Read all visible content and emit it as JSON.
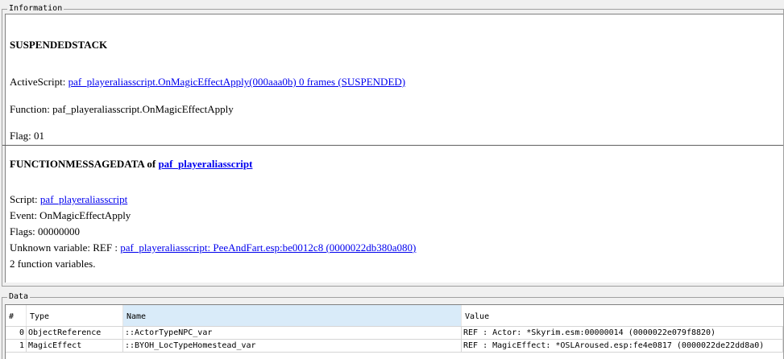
{
  "information": {
    "legend": "Information",
    "heading": "SUSPENDEDSTACK",
    "active_script_label": "ActiveScript: ",
    "active_script_link": "paf_playeraliasscript.OnMagicEffectApply(000aaa0b) 0 frames (SUSPENDED)",
    "function_line": "Function: paf_playeraliasscript.OnMagicEffectApply",
    "flag_line": "Flag: 01",
    "fmd_heading": "FUNCTIONMESSAGEDATA of ",
    "fmd_heading_link": "paf_playeraliasscript",
    "script_label": "Script: ",
    "script_link": "paf_playeraliasscript",
    "event_line": "Event: OnMagicEffectApply",
    "flags_line": "Flags: 00000000",
    "unknown_var_label": "Unknown variable: REF : ",
    "unknown_var_link": "paf_playeraliasscript: PeeAndFart.esp:be0012c8 (0000022db380a080)",
    "func_vars_line": "2 function variables."
  },
  "data": {
    "legend": "Data",
    "columns": [
      "#",
      "Type",
      "Name",
      "Value"
    ],
    "rows": [
      {
        "num": "0",
        "type": "ObjectReference",
        "name": "::ActorTypeNPC_var",
        "value": "REF : Actor: *Skyrim.esm:00000014 (0000022e079f8820)"
      },
      {
        "num": "1",
        "type": "MagicEffect",
        "name": "::BYOH_LocTypeHomestead_var",
        "value": "REF : MagicEffect: *OSLAroused.esp:fe4e0817 (0000022de22dd8a0)"
      }
    ]
  }
}
